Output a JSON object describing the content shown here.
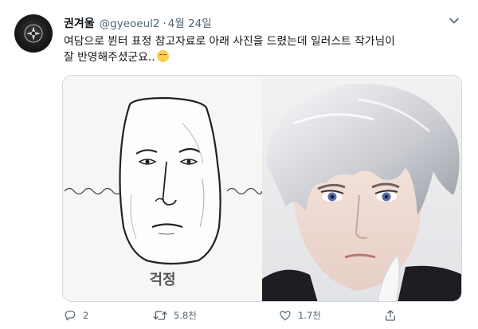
{
  "author": {
    "name": "권겨울",
    "handle": "@gyeoeul2",
    "separator": "·",
    "date": "4월 24일"
  },
  "tweet": {
    "line1": "여담으로 뷘터 표정 참고자료로 아래 사진을 드렸는데 일러스트 작가님이",
    "line2": "잘 반영해주셨군요..",
    "emoji": "grinning-face-emoji"
  },
  "media": {
    "left_caption": "걱정"
  },
  "actions": {
    "reply": {
      "icon": "reply-icon",
      "count": "2"
    },
    "retweet": {
      "icon": "retweet-icon",
      "count": "5.8천"
    },
    "like": {
      "icon": "heart-icon",
      "count": "1.7천"
    },
    "share": {
      "icon": "share-icon"
    }
  },
  "colors": {
    "text": "#0f1419",
    "muted": "#536471",
    "border": "#cfd9de"
  }
}
